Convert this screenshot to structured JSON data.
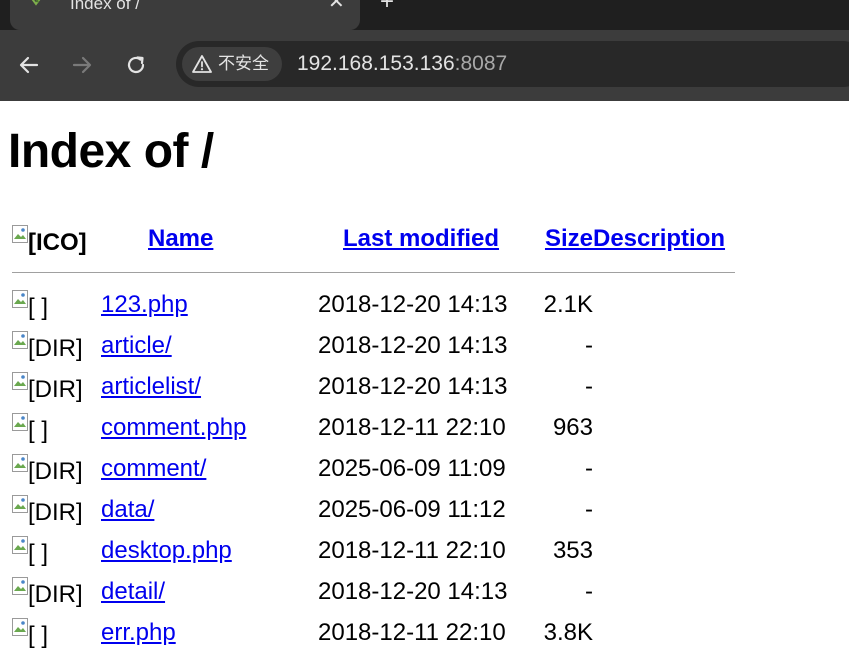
{
  "browser": {
    "tab": {
      "title": "Index of /",
      "close": "✕"
    },
    "new_tab": "+",
    "security_label": "不安全",
    "url_host": "192.168.153.136",
    "url_port": ":8087"
  },
  "page": {
    "heading": "Index of /",
    "columns": {
      "icon": "[ICO]",
      "name": "Name",
      "modified": "Last modified",
      "size": "Size",
      "description": "Description"
    },
    "entries": [
      {
        "alt": "[   ]",
        "name": "123.php",
        "modified": "2018-12-20 14:13",
        "size": "2.1K"
      },
      {
        "alt": "[DIR]",
        "name": "article/",
        "modified": "2018-12-20 14:13",
        "size": "-"
      },
      {
        "alt": "[DIR]",
        "name": "articlelist/",
        "modified": "2018-12-20 14:13",
        "size": "-"
      },
      {
        "alt": "[   ]",
        "name": "comment.php",
        "modified": "2018-12-11 22:10",
        "size": "963"
      },
      {
        "alt": "[DIR]",
        "name": "comment/",
        "modified": "2025-06-09 11:09",
        "size": "-"
      },
      {
        "alt": "[DIR]",
        "name": "data/",
        "modified": "2025-06-09 11:12",
        "size": "-"
      },
      {
        "alt": "[   ]",
        "name": "desktop.php",
        "modified": "2018-12-11 22:10",
        "size": "353"
      },
      {
        "alt": "[DIR]",
        "name": "detail/",
        "modified": "2018-12-20 14:13",
        "size": "-"
      },
      {
        "alt": "[   ]",
        "name": "err.php",
        "modified": "2018-12-11 22:10",
        "size": "3.8K"
      }
    ]
  },
  "colors": {
    "link": "#0000ee",
    "chrome_dark": "#1f1f1f",
    "chrome_toolbar": "#3c3c3c",
    "omnibox": "#282828"
  }
}
